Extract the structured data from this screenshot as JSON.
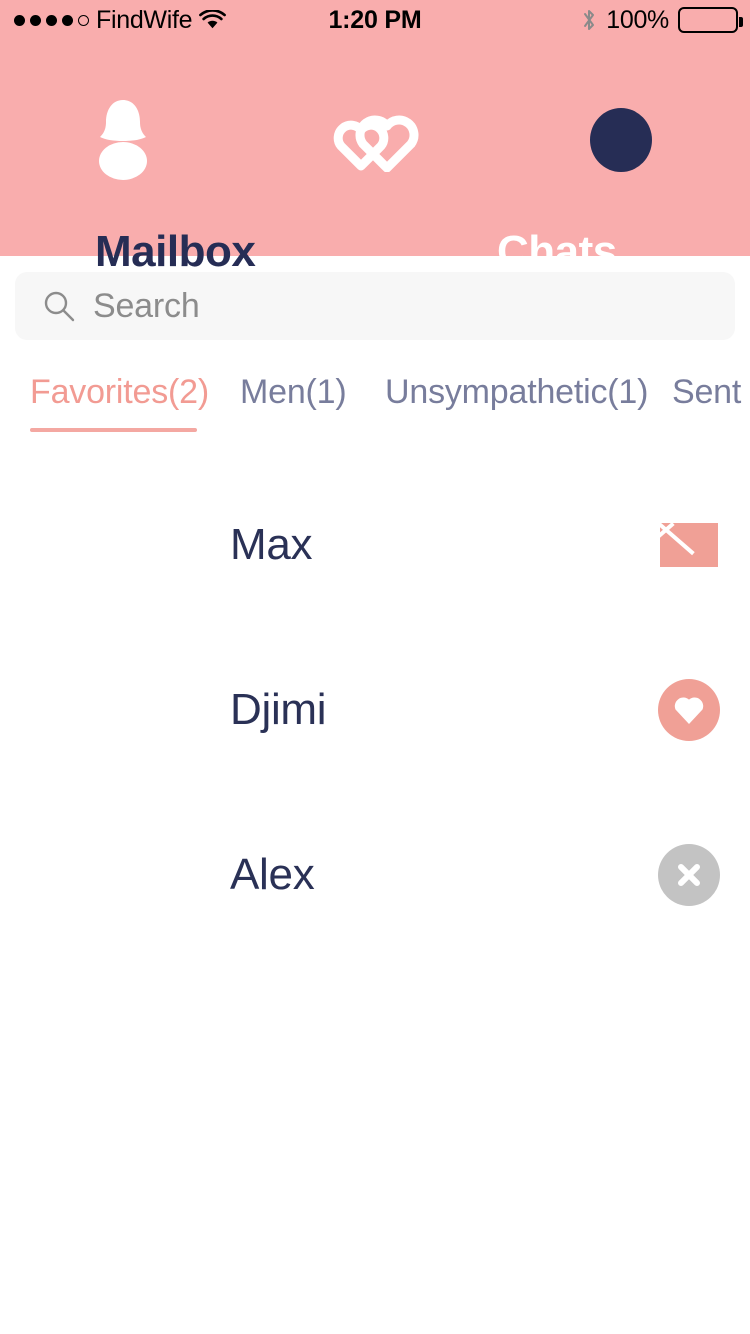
{
  "status_bar": {
    "signal_dots_filled": 4,
    "signal_dots_total": 5,
    "carrier": "FindWife",
    "wifi_icon": "wifi-icon",
    "time": "1:20 PM",
    "bluetooth_icon": "bluetooth-icon",
    "battery_percent": "100%",
    "battery_icon": "battery-icon"
  },
  "header": {
    "background_color": "#f9adad",
    "profile_icon": "profile-icon",
    "logo_icon": "double-heart-logo-icon",
    "avatar_icon": "avatar-circle-icon",
    "avatar_color": "#262d55",
    "tabs": [
      {
        "label": "Mailbox",
        "active": true,
        "color": "#262d55"
      },
      {
        "label": "Chats",
        "active": false,
        "color": "#ffffff"
      }
    ]
  },
  "search": {
    "icon": "search-icon",
    "placeholder": "Search",
    "value": "",
    "background_color": "#f7f7f7"
  },
  "filters": {
    "active_color": "#f29b93",
    "inactive_color": "#787d9c",
    "underline_color": "#f4a8a2",
    "tabs": [
      {
        "label": "Favorites(2)",
        "active": true
      },
      {
        "label": "Men(1)",
        "active": false
      },
      {
        "label": "Unsympathetic(1)",
        "active": false
      },
      {
        "label": "Sent",
        "active": false
      }
    ]
  },
  "list": {
    "rows": [
      {
        "name": "Max",
        "action_icon": "envelope-icon",
        "action_color": "#f0a096"
      },
      {
        "name": "Djimi",
        "action_icon": "heart-circle-icon",
        "action_color": "#f0a096"
      },
      {
        "name": "Alex",
        "action_icon": "close-circle-icon",
        "action_color": "#c3c3c3"
      }
    ]
  }
}
